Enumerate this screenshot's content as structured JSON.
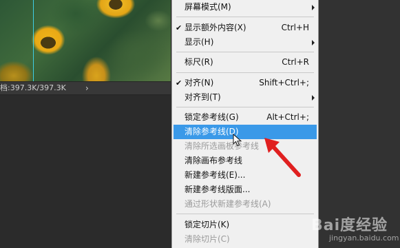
{
  "canvas": {
    "status_text": "档:397.3K/397.3K",
    "status_arrow": "›"
  },
  "menu": {
    "items": [
      {
        "label": "屏幕模式(M)",
        "shortcut": "",
        "checked": false,
        "submenu": true,
        "disabled": false
      },
      {
        "label": "显示额外内容(X)",
        "shortcut": "Ctrl+H",
        "checked": true,
        "submenu": false,
        "disabled": false
      },
      {
        "label": "显示(H)",
        "shortcut": "",
        "checked": false,
        "submenu": true,
        "disabled": false
      },
      {
        "label": "标尺(R)",
        "shortcut": "Ctrl+R",
        "checked": false,
        "submenu": false,
        "disabled": false
      },
      {
        "label": "对齐(N)",
        "shortcut": "Shift+Ctrl+;",
        "checked": true,
        "submenu": false,
        "disabled": false
      },
      {
        "label": "对齐到(T)",
        "shortcut": "",
        "checked": false,
        "submenu": true,
        "disabled": false
      },
      {
        "label": "锁定参考线(G)",
        "shortcut": "Alt+Ctrl+;",
        "checked": false,
        "submenu": false,
        "disabled": false
      },
      {
        "label": "清除参考线(D)",
        "shortcut": "",
        "checked": false,
        "submenu": false,
        "disabled": false,
        "highlighted": true
      },
      {
        "label": "清除所选画板参考线",
        "shortcut": "",
        "checked": false,
        "submenu": false,
        "disabled": true
      },
      {
        "label": "清除画布参考线",
        "shortcut": "",
        "checked": false,
        "submenu": false,
        "disabled": false
      },
      {
        "label": "新建参考线(E)...",
        "shortcut": "",
        "checked": false,
        "submenu": false,
        "disabled": false
      },
      {
        "label": "新建参考线版面...",
        "shortcut": "",
        "checked": false,
        "submenu": false,
        "disabled": false
      },
      {
        "label": "通过形状新建参考线(A)",
        "shortcut": "",
        "checked": false,
        "submenu": false,
        "disabled": true
      },
      {
        "label": "锁定切片(K)",
        "shortcut": "",
        "checked": false,
        "submenu": false,
        "disabled": false
      },
      {
        "label": "清除切片(C)",
        "shortcut": "",
        "checked": false,
        "submenu": false,
        "disabled": true
      }
    ]
  },
  "watermark": {
    "brand": "Bai度经验",
    "sub": "jingyan.baidu.com"
  },
  "colors": {
    "highlight": "#3a99e8",
    "arrow": "#e02020"
  },
  "icons": {
    "checkmark": "checkmark-icon",
    "submenu": "submenu-arrow-icon",
    "cursor": "mouse-pointer-icon",
    "annotation": "red-arrow-icon"
  }
}
